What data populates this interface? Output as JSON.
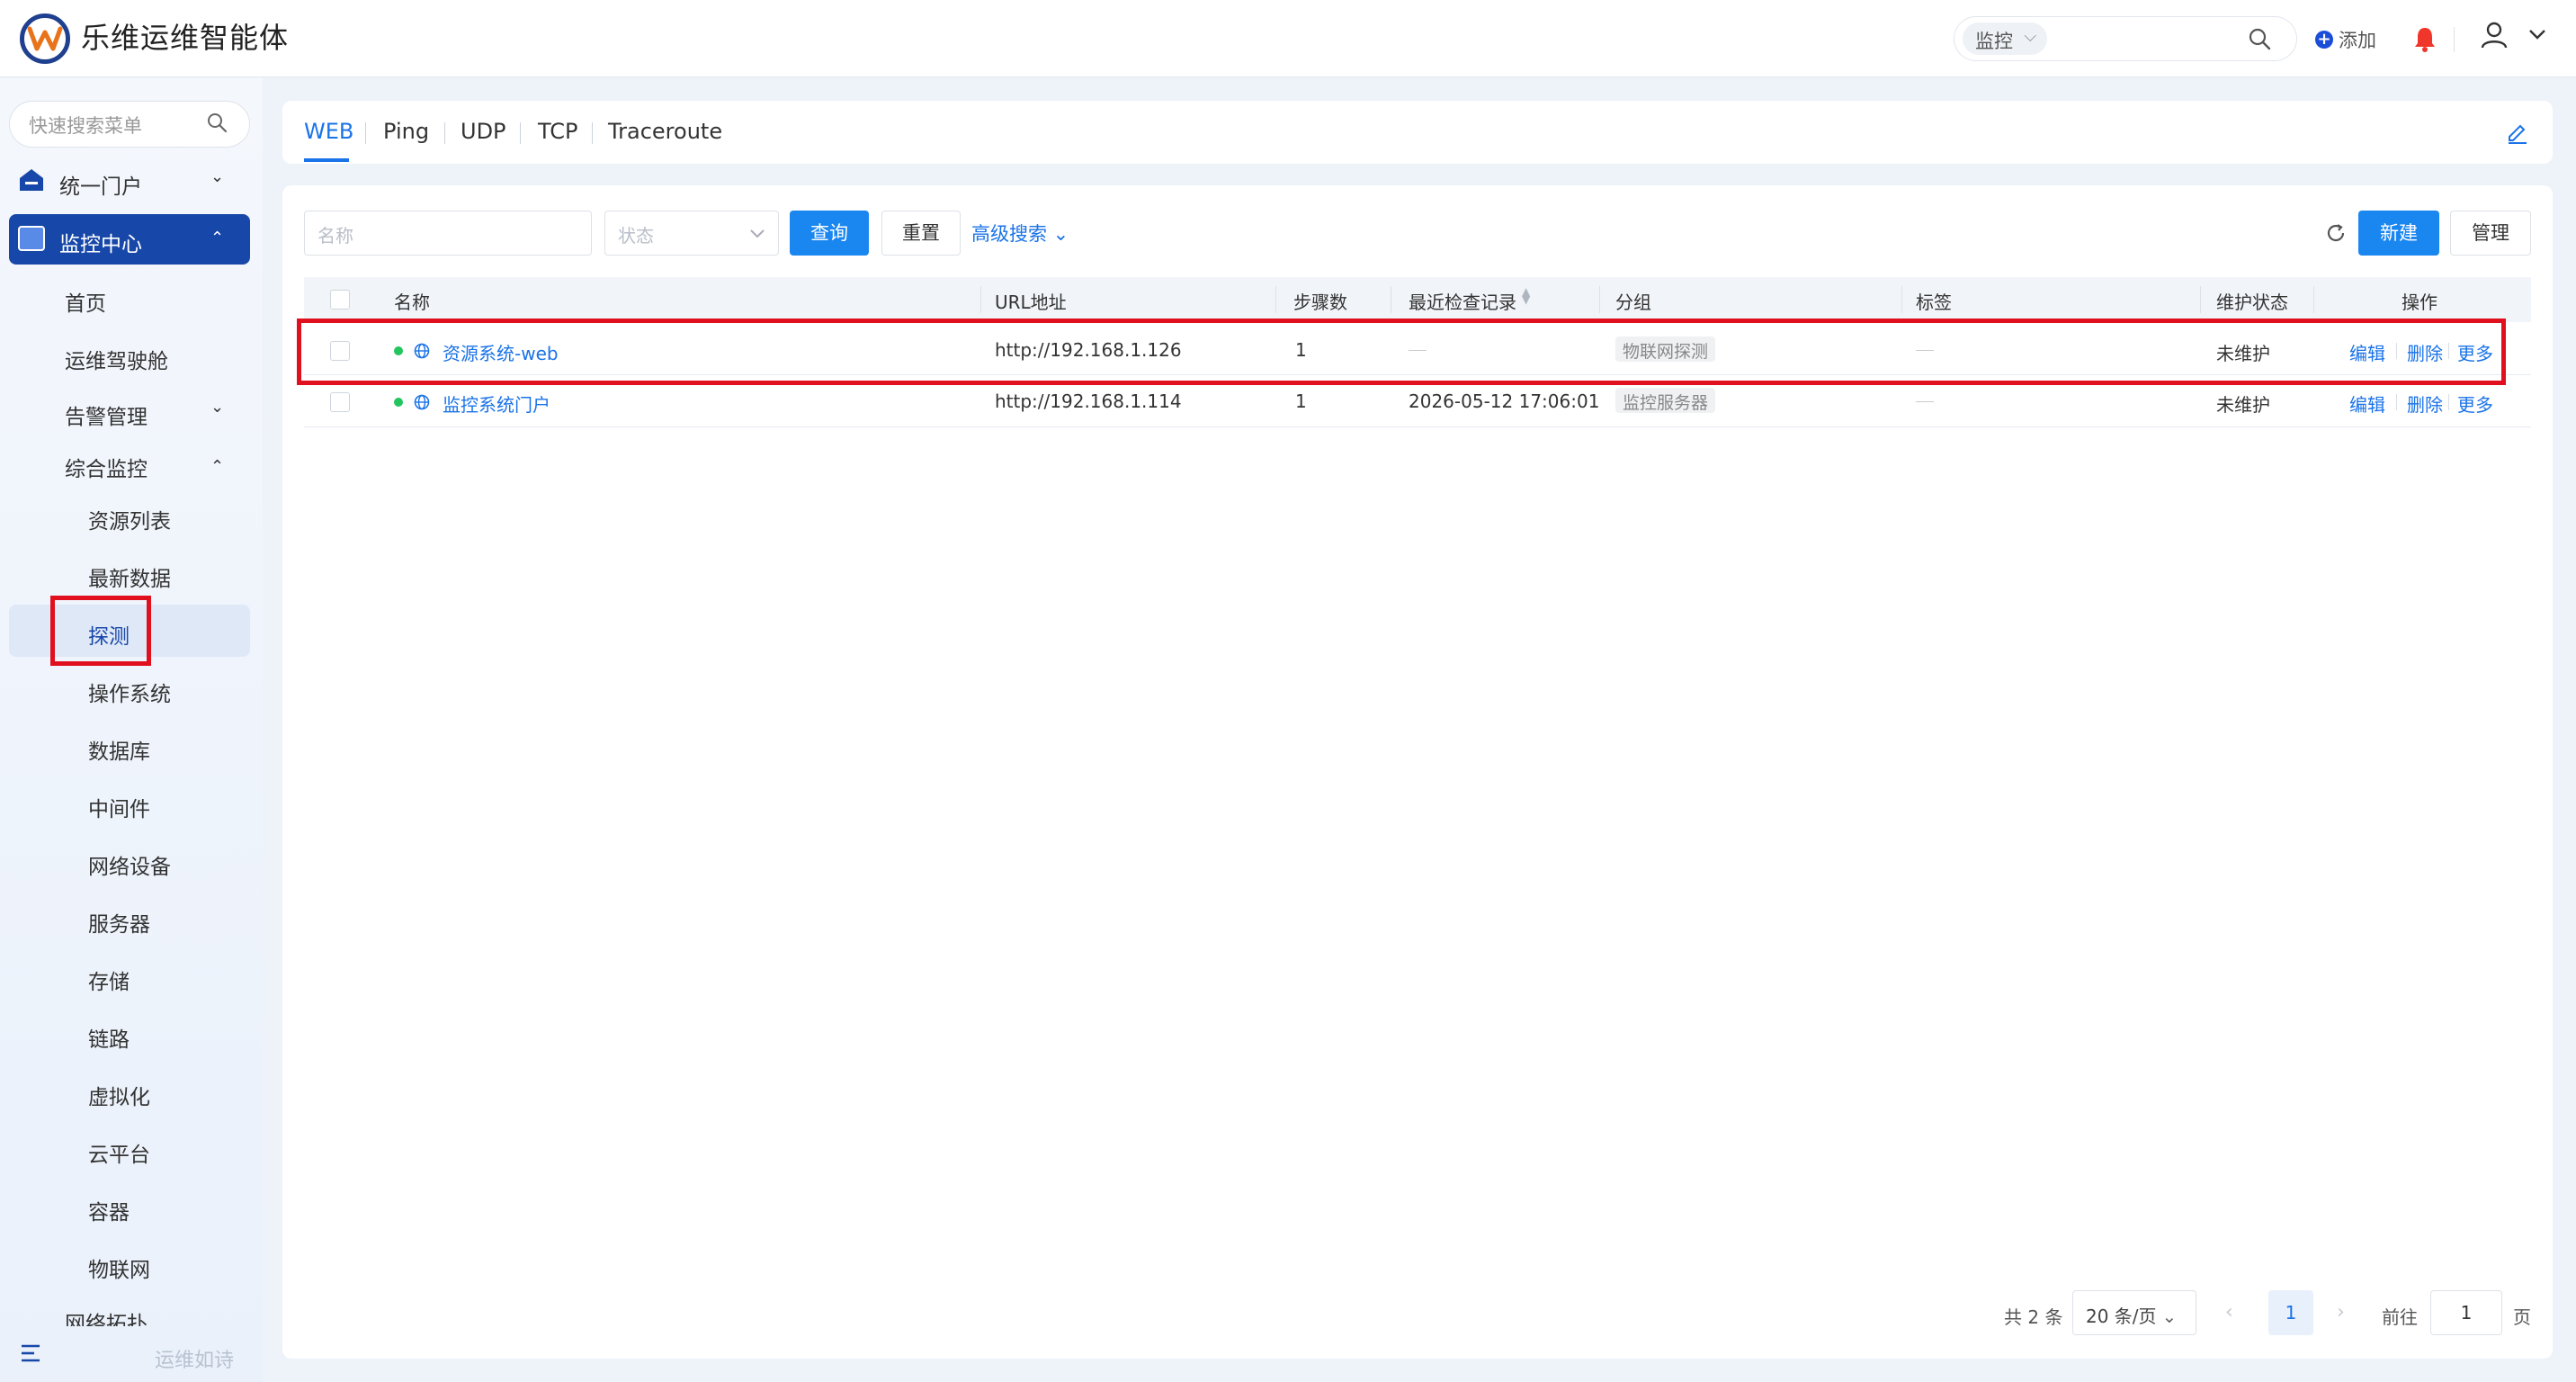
{
  "header": {
    "app_title": "乐维运维智能体",
    "scope_select": "监控",
    "add_label": "添加"
  },
  "sidebar": {
    "search_placeholder": "快速搜索菜单",
    "portal": "统一门户",
    "monitor_center": "监控中心",
    "home": "首页",
    "cockpit": "运维驾驶舱",
    "alarm": "告警管理",
    "integrated": "综合监控",
    "sub": [
      "资源列表",
      "最新数据",
      "探测",
      "操作系统",
      "数据库",
      "中间件",
      "网络设备",
      "服务器",
      "存储",
      "链路",
      "虚拟化",
      "云平台",
      "容器",
      "物联网"
    ],
    "topology": "网络拓扑",
    "footer": "运维如诗"
  },
  "tabs": [
    "WEB",
    "Ping",
    "UDP",
    "TCP",
    "Traceroute"
  ],
  "filters": {
    "name_placeholder": "名称",
    "status_placeholder": "状态",
    "query": "查询",
    "reset": "重置",
    "advanced": "高级搜索",
    "new": "新建",
    "manage": "管理"
  },
  "table": {
    "headers": [
      "名称",
      "URL地址",
      "步骤数",
      "最近检查记录",
      "分组",
      "标签",
      "维护状态",
      "操作"
    ],
    "rows": [
      {
        "name": "资源系统-web",
        "url": "http://192.168.1.126",
        "steps": "1",
        "last_check": "",
        "group": "物联网探测",
        "maint": "未维护"
      },
      {
        "name": "监控系统门户",
        "url": "http://192.168.1.114",
        "steps": "1",
        "last_check": "2026-05-12 17:06:01",
        "group": "监控服务器",
        "maint": "未维护"
      }
    ],
    "ops": [
      "编辑",
      "删除",
      "更多"
    ]
  },
  "pagination": {
    "total": "共 2 条",
    "page_size": "20 条/页",
    "current": "1",
    "goto_label": "前往",
    "goto_value": "1",
    "unit": "页"
  },
  "colors": {
    "primary": "#1a86f0",
    "nav_active": "#1747a8",
    "highlight": "#e0101e",
    "status_ok": "#22c55e"
  }
}
